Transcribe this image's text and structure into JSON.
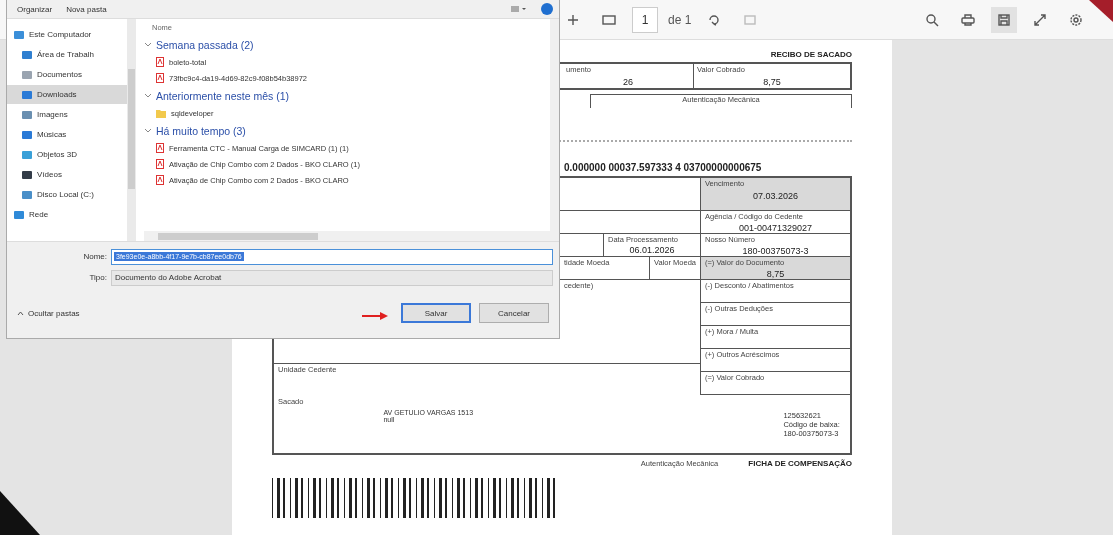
{
  "dialog": {
    "organize_menu": "Organizar",
    "new_folder": "Nova pasta",
    "nav": [
      {
        "label": "Este Computador",
        "kind": "computer",
        "selected": false,
        "indented": false
      },
      {
        "label": "Área de Trabalh",
        "kind": "desktop",
        "selected": false,
        "indented": true
      },
      {
        "label": "Documentos",
        "kind": "documents",
        "selected": false,
        "indented": true
      },
      {
        "label": "Downloads",
        "kind": "downloads",
        "selected": true,
        "indented": true
      },
      {
        "label": "Imagens",
        "kind": "pictures",
        "selected": false,
        "indented": true
      },
      {
        "label": "Músicas",
        "kind": "music",
        "selected": false,
        "indented": true
      },
      {
        "label": "Objetos 3D",
        "kind": "objects",
        "selected": false,
        "indented": true
      },
      {
        "label": "Vídeos",
        "kind": "videos",
        "selected": false,
        "indented": true
      },
      {
        "label": "Disco Local (C:)",
        "kind": "drive",
        "selected": false,
        "indented": true
      },
      {
        "label": "Rede",
        "kind": "network",
        "selected": false,
        "indented": false
      }
    ],
    "column_header": "Nome",
    "groups": [
      {
        "title": "Semana passada (2)",
        "expanded": true,
        "items": [
          {
            "name": "boleto-total",
            "kind": "pdf"
          },
          {
            "name": "73fbc9c4-da19-4d69-82c9-f08b54b38972",
            "kind": "pdf"
          }
        ]
      },
      {
        "title": "Anteriormente neste mês (1)",
        "expanded": true,
        "items": [
          {
            "name": "sqldeveloper",
            "kind": "folder"
          }
        ]
      },
      {
        "title": "Há muito tempo (3)",
        "expanded": true,
        "items": [
          {
            "name": "Ferramenta CTC - Manual Carga de SIMCARD (1) (1)",
            "kind": "pdf"
          },
          {
            "name": "Ativação de Chip Combo com 2 Dados - BKO CLARO (1)",
            "kind": "pdf"
          },
          {
            "name": "Ativação de Chip Combo com 2 Dados - BKO CLARO",
            "kind": "pdf"
          }
        ]
      }
    ],
    "file_name": {
      "label": "Nome:",
      "value": "3fe93e0e-a8bb-4f17-9e7b-cb87ee0db76"
    },
    "file_type": {
      "label": "Tipo:",
      "value": "Documento do Adobe Acrobat"
    },
    "hide_folders": "Ocultar pastas",
    "buttons": [
      {
        "label": "Salvar",
        "default": true
      },
      {
        "label": "Cancelar",
        "default": false
      }
    ]
  },
  "viewer": {
    "page": "1",
    "page_count": "de 1",
    "document": {
      "receipt_title": "RECIBO DE SACADO",
      "receipt_cells": [
        {
          "label": "umento",
          "value": "26"
        },
        {
          "label": "Valor Cobrado",
          "value": "8,75"
        }
      ],
      "receipt_auth": "Autenticação Mecânica",
      "digitable_line": "0.000000 00037.597333 4 03700000000675",
      "right_fields": [
        {
          "label": "Vencimento",
          "value": "07.03.2026",
          "shaded": true
        },
        {
          "label": "Agência / Código do Cedente",
          "value": "001-00471329027",
          "shaded": false
        },
        {
          "label": "Nosso Número",
          "value": "180-00375073-3",
          "shaded": false
        },
        {
          "label": "(=) Valor do Documento",
          "value": "8,75",
          "shaded": true
        },
        {
          "label": "(-) Desconto / Abatimentos",
          "shaded": false
        },
        {
          "label": "(-) Outras Deduções",
          "shaded": false
        },
        {
          "label": "(+) Mora / Multa",
          "shaded": false
        },
        {
          "label": "(+) Outros Acréscimos",
          "shaded": false
        },
        {
          "label": "(=) Valor Cobrado",
          "shaded": false
        }
      ],
      "processing_date": {
        "label": "Data Processamento",
        "value": "06.01.2026"
      },
      "currency_quantity": "tidade Moeda",
      "currency_value": "Valor Moeda",
      "instructions": "cedente)",
      "unit": "Unidade Cedente",
      "payer_label": "Sacado",
      "payer_address": [
        "AV GETULIO VARGAS 1513",
        "null"
      ],
      "payer_codes": [
        "125632621",
        "Código de baixa:",
        "180-00375073-3"
      ],
      "auth_label": "Autenticação Mecânica",
      "slip_title": "FICHA DE COMPENSAÇÃO"
    }
  }
}
